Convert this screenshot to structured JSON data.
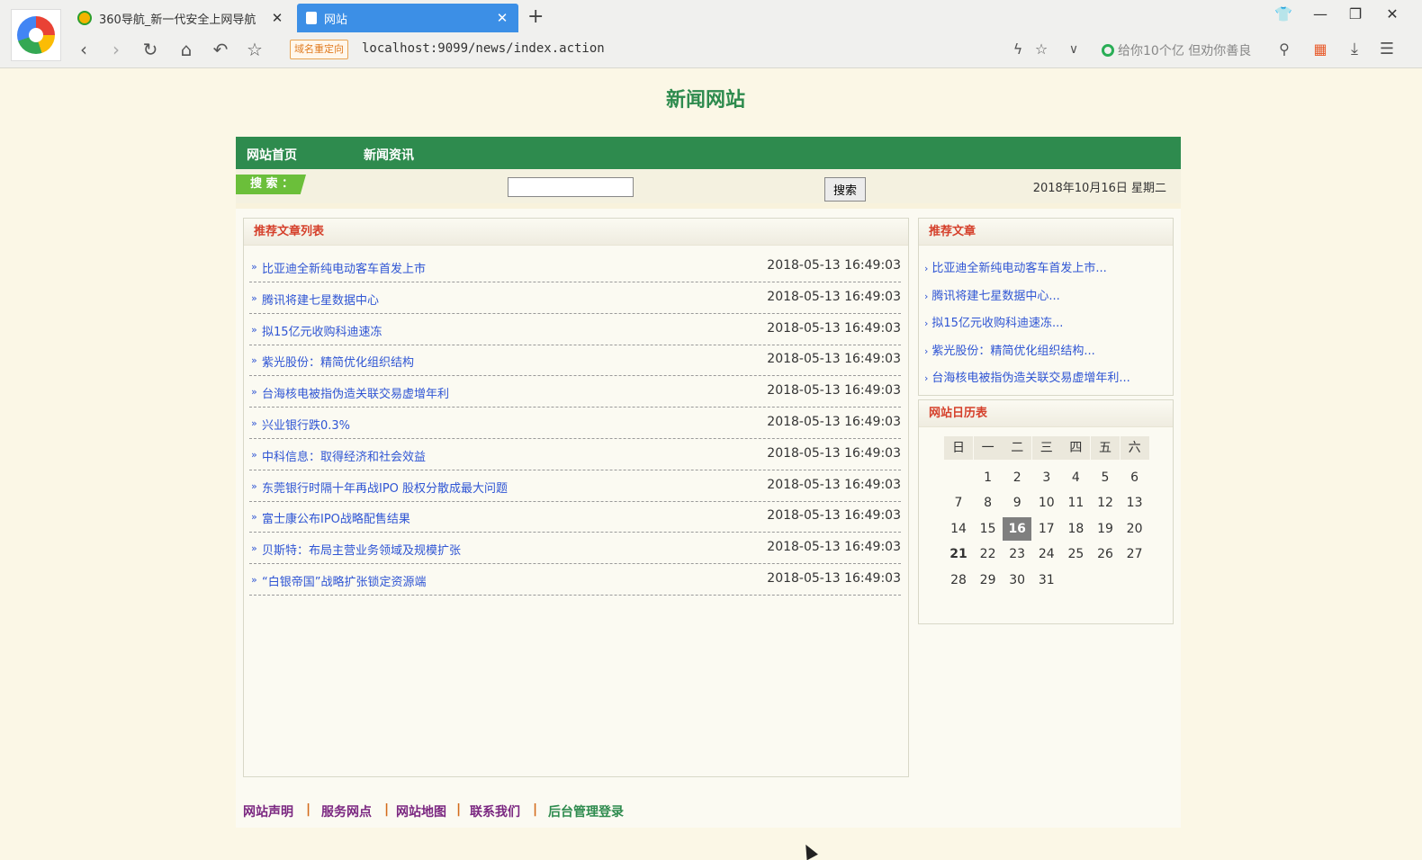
{
  "browser": {
    "tabs": [
      {
        "title": "360导航_新一代安全上网导航",
        "active": false
      },
      {
        "title": "网站",
        "active": true
      }
    ],
    "url": "localhost:9099/news/index.action",
    "redirect_badge": "域名重定向",
    "search_hint": "给你10个亿 但劝你善良",
    "icons": [
      "back-icon",
      "forward-icon",
      "reload-icon",
      "home-icon",
      "undo-icon",
      "star-icon",
      "flash-icon",
      "search-icon",
      "apps-icon",
      "download-icon",
      "menu-icon"
    ]
  },
  "site": {
    "title": "新闻网站",
    "nav": [
      "网站首页",
      "新闻资讯"
    ],
    "search": {
      "label": "搜 索 ：",
      "button": "搜索",
      "value": ""
    },
    "date": "2018年10月16日 星期二",
    "main_list": {
      "heading": "推荐文章列表",
      "articles": [
        {
          "title": "比亚迪全新纯电动客车首发上市",
          "time": "2018-05-13 16:49:03"
        },
        {
          "title": "腾讯将建七星数据中心",
          "time": "2018-05-13 16:49:03"
        },
        {
          "title": "拟15亿元收购科迪速冻",
          "time": "2018-05-13 16:49:03"
        },
        {
          "title": "紫光股份：精简优化组织结构",
          "time": "2018-05-13 16:49:03"
        },
        {
          "title": "台海核电被指伪造关联交易虚增年利",
          "time": "2018-05-13 16:49:03"
        },
        {
          "title": "兴业银行跌0.3%",
          "time": "2018-05-13 16:49:03"
        },
        {
          "title": "中科信息：取得经济和社会效益",
          "time": "2018-05-13 16:49:03"
        },
        {
          "title": "东莞银行时隔十年再战IPO 股权分散成最大问题",
          "time": "2018-05-13 16:49:03"
        },
        {
          "title": "富士康公布IPO战略配售结果",
          "time": "2018-05-13 16:49:03"
        },
        {
          "title": "贝斯特：布局主营业务领域及规模扩张",
          "time": "2018-05-13 16:49:03"
        },
        {
          "title": "“白银帝国”战略扩张锁定资源端",
          "time": "2018-05-13 16:49:03"
        }
      ]
    },
    "recommend": {
      "heading": "推荐文章",
      "items": [
        "比亚迪全新纯电动客车首发上市...",
        "腾讯将建七星数据中心...",
        "拟15亿元收购科迪速冻...",
        "紫光股份：精简优化组织结构...",
        "台海核电被指伪造关联交易虚增年利..."
      ]
    },
    "calendar": {
      "heading": "网站日历表",
      "weekdays": [
        "日",
        "一",
        "二",
        "三",
        "四",
        "五",
        "六"
      ],
      "first_weekday": 1,
      "days": 31,
      "today": 16
    },
    "footer": [
      "网站声明",
      "服务网点",
      "网站地图",
      "联系我们",
      "后台管理登录"
    ],
    "footer_sep": "|",
    "colors": {
      "green": "#2e8b4e",
      "link": "#2f55d4",
      "heading_red": "#d5402b"
    }
  }
}
